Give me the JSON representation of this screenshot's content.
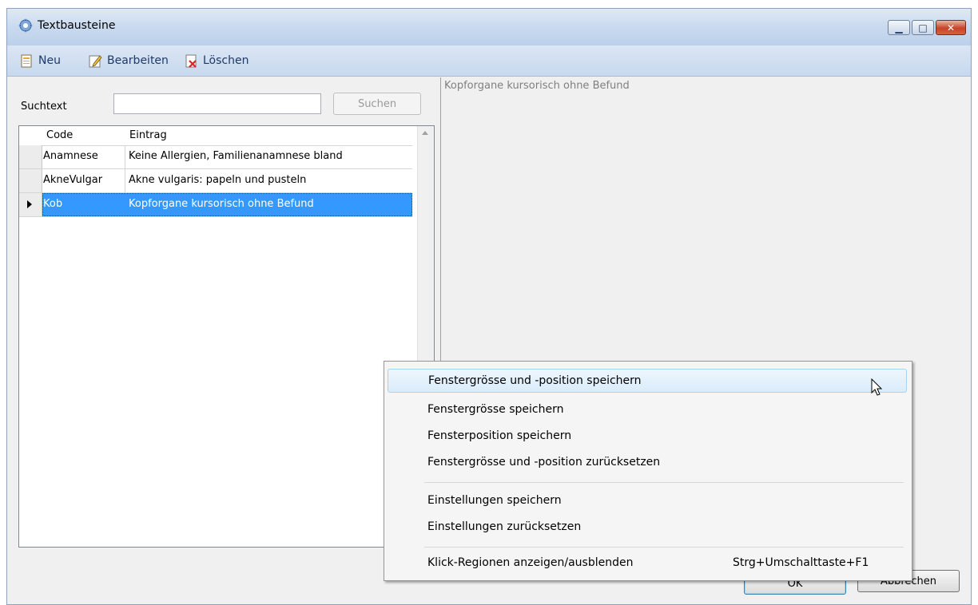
{
  "window": {
    "title": "Textbausteine",
    "minimize_glyph": "▁",
    "maximize_glyph": "□",
    "close_glyph": "✕"
  },
  "toolbar": {
    "new_label": "Neu",
    "edit_label": "Bearbeiten",
    "delete_label": "Löschen",
    "new_icon": "new-document-icon",
    "edit_icon": "edit-pencil-icon",
    "delete_icon": "delete-document-icon"
  },
  "search": {
    "label": "Suchtext",
    "value": "",
    "button_label": "Suchen"
  },
  "table": {
    "headers": [
      "Code",
      "Eintrag"
    ],
    "rows": [
      {
        "code": "Anamnese",
        "entry": "Keine Allergien, Familienanamnese bland"
      },
      {
        "code": "AkneVulgar",
        "entry": "Akne vulgaris: papeln und pusteln"
      },
      {
        "code": "Kob",
        "entry": "Kopforgane kursorisch ohne Befund"
      }
    ],
    "selected_index": 2
  },
  "preview": {
    "text": "Kopforgane kursorisch ohne Befund"
  },
  "buttons": {
    "ok_label": "OK",
    "cancel_label": "Abbrechen"
  },
  "context_menu": {
    "items": [
      {
        "label": "Fenstergrösse und -position speichern",
        "shortcut": ""
      },
      {
        "label": "Fenstergrösse speichern",
        "shortcut": ""
      },
      {
        "label": "Fensterposition speichern",
        "shortcut": ""
      },
      {
        "label": "Fenstergrösse und -position zurücksetzen",
        "shortcut": ""
      },
      {
        "label": "Einstellungen speichern",
        "shortcut": ""
      },
      {
        "label": "Einstellungen zurücksetzen",
        "shortcut": ""
      },
      {
        "label": "Klick-Regionen anzeigen/ausblenden",
        "shortcut": "Strg+Umschalttaste+F1"
      }
    ],
    "hovered_index": 0
  },
  "colors": {
    "selection": "#3399ff",
    "title_bar": "#c9daef",
    "close_button": "#c7432a"
  }
}
